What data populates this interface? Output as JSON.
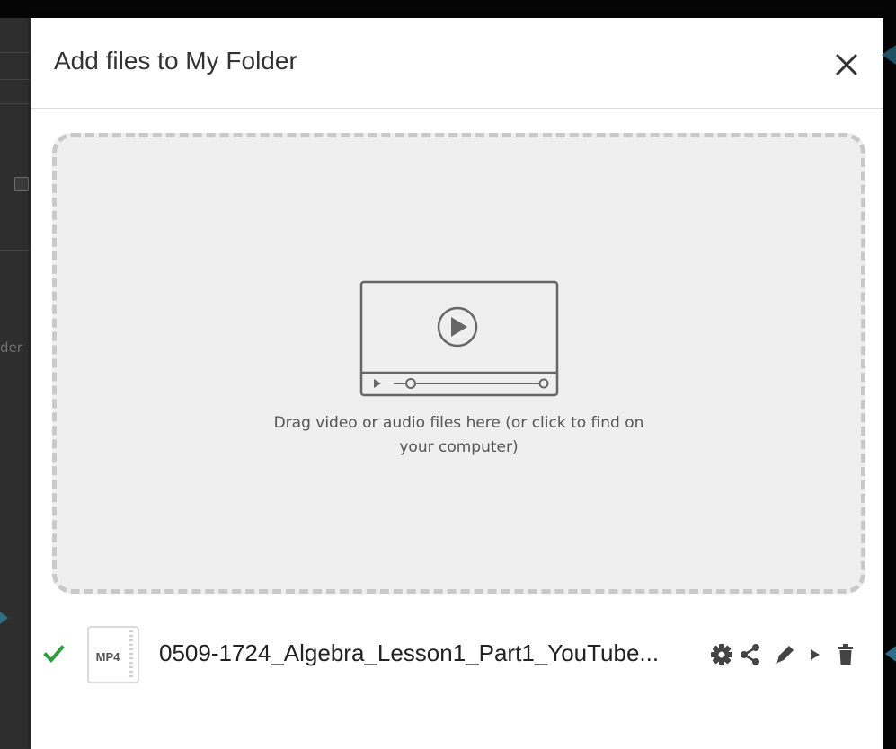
{
  "modal": {
    "title": "Add files to My Folder"
  },
  "dropzone": {
    "instructions": "Drag video or audio files here (or click to find on your computer)",
    "icon": "video-player-icon"
  },
  "file": {
    "name": "0509-1724_Algebra_Lesson1_Part1_YouTube...",
    "type_badge": "MP4",
    "status": "uploaded",
    "status_icon": "checkmark-icon",
    "actions": [
      "settings",
      "share",
      "edit",
      "play",
      "delete"
    ]
  },
  "background": {
    "partial_text": "der"
  },
  "colors": {
    "check_green": "#2e9e3e",
    "icon_gray": "#555555",
    "dropzone_bg": "#efefef",
    "dropzone_border": "#c9c9c9"
  }
}
